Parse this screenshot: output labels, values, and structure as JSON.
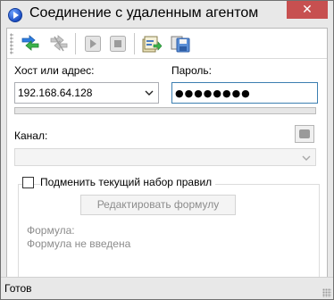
{
  "window": {
    "title": "Соединение с удаленным агентом",
    "close_glyph": "✕"
  },
  "toolbar": {
    "buttons": [
      {
        "name": "connect-icon",
        "enabled": true
      },
      {
        "name": "disconnect-icon",
        "enabled": false
      },
      {
        "name": "play-icon",
        "enabled": false
      },
      {
        "name": "stop-icon",
        "enabled": false
      },
      {
        "name": "open-icon",
        "enabled": true
      },
      {
        "name": "save-icon",
        "enabled": true
      }
    ]
  },
  "form": {
    "host_label": "Хост или адрес:",
    "host_value": "192.168.64.128",
    "password_label": "Пароль:",
    "password_value": "●●●●●●●●",
    "progress_percent": 0,
    "channel_label": "Канал:",
    "channel_value": "",
    "replace_rules_label": "Подменить текущий набор правил",
    "replace_rules_checked": false,
    "edit_formula_label": "Редактировать формулу",
    "formula_label": "Формула:",
    "formula_status": "Формула не введена"
  },
  "status": {
    "text": "Готов"
  },
  "colors": {
    "close_button": "#c75050",
    "focus_border": "#3c7fb1",
    "disabled_text": "#8c8c8c"
  }
}
